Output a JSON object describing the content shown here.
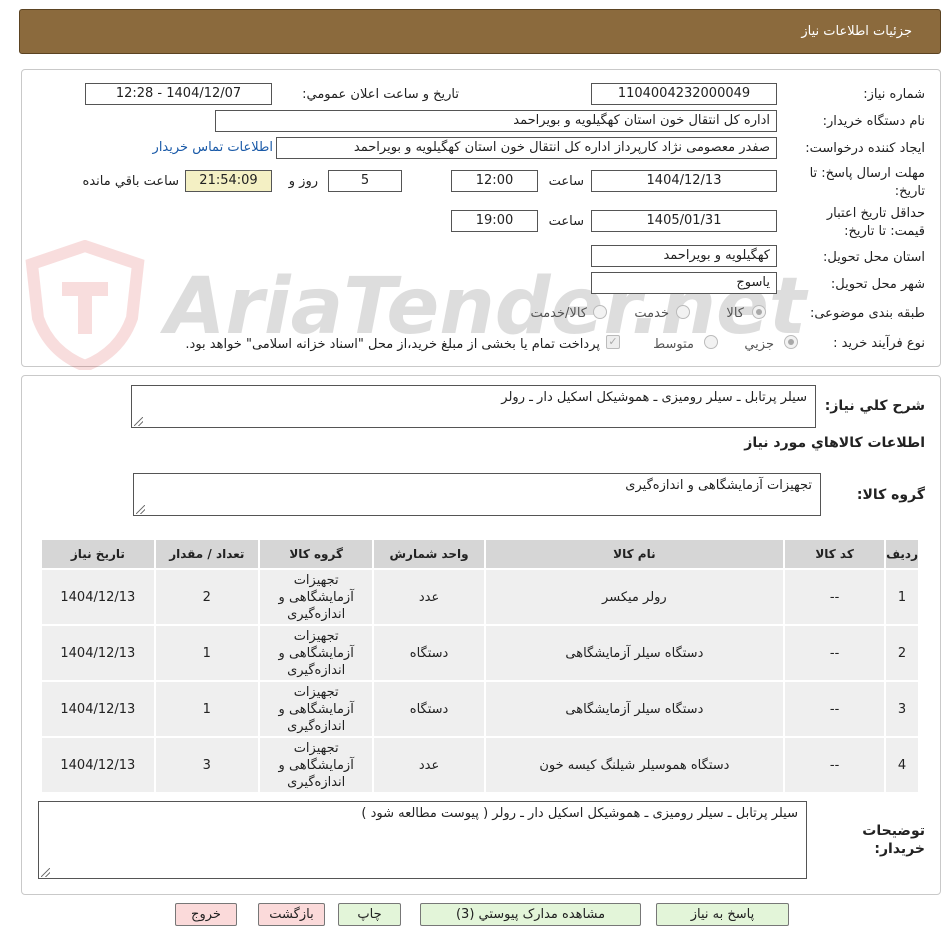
{
  "header": {
    "title": "جزئیات اطلاعات نیاز"
  },
  "need": {
    "number_label": "شماره نیاز:",
    "number": "1104004232000049",
    "announce_label": "تاریخ و ساعت اعلان عمومي:",
    "announce": "1404/12/07 - 12:28",
    "buyer_label": "نام دستگاه خریدار:",
    "buyer": "اداره کل انتقال خون استان کهگیلویه و بویراحمد",
    "creator_label": "ایجاد کننده درخواست:",
    "creator": "صفدر معصومی نژاد کارپرداز اداره کل انتقال خون استان کهگیلویه و بویراحمد",
    "contact_link": "اطلاعات تماس خریدار",
    "deadline_label_1": "مهلت ارسال پاسخ: تا",
    "deadline_label_2": "تاریخ:",
    "deadline_date": "1404/12/13",
    "deadline_time_label": "ساعت",
    "deadline_time": "12:00",
    "days_value": "5",
    "days_label": "روز و",
    "remaining_time": "21:54:09",
    "remaining_label": "ساعت باقي مانده",
    "validity_label_1": "حداقل تاریخ اعتبار",
    "validity_label_2": "قیمت: تا تاریخ:",
    "validity_date": "1405/01/31",
    "validity_time_label": "ساعت",
    "validity_time": "19:00",
    "province_label": "استان محل تحویل:",
    "province": "کهگیلویه و بویراحمد",
    "city_label": "شهر محل تحویل:",
    "city": "یاسوج",
    "category_label": "طبقه بندی موضوعی:",
    "category_options": [
      "کالا",
      "خدمت",
      "کالا/خدمت"
    ],
    "process_label": "نوع فرآیند خرید :",
    "process_options": [
      "جزیي",
      "متوسط"
    ],
    "payment_note": "پرداخت تمام یا بخشی از مبلغ خرید،از محل \"اسناد خزانه اسلامی\" خواهد بود."
  },
  "summary": {
    "label": "شرح كلي نياز:",
    "text": "سیلر پرتابل  ـ سیلر رومیزی ـ هموشیکل اسکیل دار ـ رولر"
  },
  "goods": {
    "section_title": "اطلاعات كالاهاي مورد نياز",
    "group_label": "گروه کالا:",
    "group_value": "تجهیزات آزمایشگاهی و اندازه‌گیری",
    "columns": [
      "ردیف",
      "کد کالا",
      "نام کالا",
      "واحد شمارش",
      "گروه کالا",
      "تعداد / مقدار",
      "تاریخ نیاز"
    ],
    "rows": [
      {
        "row": "1",
        "code": "--",
        "name": "رولر میکسر",
        "unit": "عدد",
        "group": "تجهیزات آزمایشگاهی و اندازه‌گیری",
        "qty": "2",
        "date": "1404/12/13"
      },
      {
        "row": "2",
        "code": "--",
        "name": "دستگاه سیلر آزمایشگاهی",
        "unit": "دستگاه",
        "group": "تجهیزات آزمایشگاهی و اندازه‌گیری",
        "qty": "1",
        "date": "1404/12/13"
      },
      {
        "row": "3",
        "code": "--",
        "name": "دستگاه سیلر آزمایشگاهی",
        "unit": "دستگاه",
        "group": "تجهیزات آزمایشگاهی و اندازه‌گیری",
        "qty": "1",
        "date": "1404/12/13"
      },
      {
        "row": "4",
        "code": "--",
        "name": "دستگاه هموسیلر شیلنگ کیسه خون",
        "unit": "عدد",
        "group": "تجهیزات آزمایشگاهی و اندازه‌گیری",
        "qty": "3",
        "date": "1404/12/13"
      }
    ]
  },
  "buyer_notes": {
    "label_1": "توضیحات",
    "label_2": "خریدار:",
    "text": "سیلر پرتابل  ـ سیلر رومیزی ـ هموشیکل اسکیل دار ـ رولر  ( پیوست مطالعه شود )"
  },
  "buttons": {
    "reply": "پاسخ به نیاز",
    "attachments": "مشاهده مدارک پیوستي (3)",
    "print": "چاپ",
    "back": "بازگشت",
    "exit": "خروج"
  },
  "watermark": {
    "text": "AriaTender.net"
  },
  "colors": {
    "header": "#8b6a3d",
    "time_highlight": "#f4f0c4",
    "link": "#1a5aa8",
    "green_button": "#e3f5d9",
    "red_button": "#fbdada"
  }
}
